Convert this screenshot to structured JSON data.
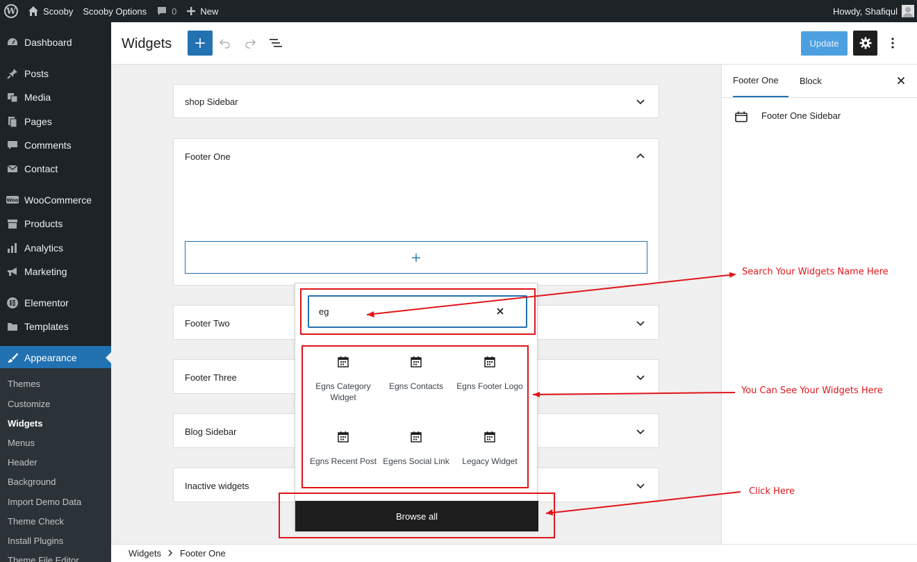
{
  "adminbar": {
    "site_name": "Scooby",
    "options_label": "Scooby Options",
    "comments_count": "0",
    "new_label": "New",
    "greeting": "Howdy, Shafiqul"
  },
  "sidebar": {
    "items": [
      {
        "label": "Dashboard",
        "icon": "dashboard-icon"
      },
      {
        "label": "Posts",
        "icon": "pin-icon"
      },
      {
        "label": "Media",
        "icon": "media-icon"
      },
      {
        "label": "Pages",
        "icon": "pages-icon"
      },
      {
        "label": "Comments",
        "icon": "comment-icon"
      },
      {
        "label": "Contact",
        "icon": "mail-icon"
      },
      {
        "label": "WooCommerce",
        "icon": "woo-icon"
      },
      {
        "label": "Products",
        "icon": "archive-icon"
      },
      {
        "label": "Analytics",
        "icon": "chart-icon"
      },
      {
        "label": "Marketing",
        "icon": "megaphone-icon"
      },
      {
        "label": "Elementor",
        "icon": "elementor-icon"
      },
      {
        "label": "Templates",
        "icon": "folder-icon"
      },
      {
        "label": "Appearance",
        "icon": "brush-icon"
      }
    ],
    "submenu": [
      "Themes",
      "Customize",
      "Widgets",
      "Menus",
      "Header",
      "Background",
      "Import Demo Data",
      "Theme Check",
      "Install Plugins",
      "Theme File Editor"
    ],
    "current_submenu": "Widgets"
  },
  "header": {
    "title": "Widgets",
    "update_label": "Update"
  },
  "widget_areas": [
    {
      "title": "shop Sidebar"
    },
    {
      "title": "Footer One"
    },
    {
      "title": "Footer Two"
    },
    {
      "title": "Footer Three"
    },
    {
      "title": "Blog Sidebar"
    },
    {
      "title": "Inactive widgets"
    }
  ],
  "inserter": {
    "search_value": "eg",
    "blocks": [
      {
        "label": "Egns Category Widget",
        "icon": "calendar-icon"
      },
      {
        "label": "Egns Contacts",
        "icon": "calendar-icon"
      },
      {
        "label": "Egns Footer Logo",
        "icon": "calendar-icon"
      },
      {
        "label": "Egns Recent Post",
        "icon": "calendar-icon"
      },
      {
        "label": "Egens Social Link",
        "icon": "calendar-icon"
      },
      {
        "label": "Legacy Widget",
        "icon": "calendar-icon"
      }
    ],
    "browse_all_label": "Browse all"
  },
  "right_panel": {
    "tabs": [
      "Footer One",
      "Block"
    ],
    "active_tab": "Footer One",
    "item_label": "Footer One Sidebar"
  },
  "breadcrumb": [
    "Widgets",
    "Footer One"
  ],
  "annotations": {
    "search_note": "Search Your Widgets Name Here",
    "widgets_note": "You Can See Your Widgets Here",
    "click_note": "Click Here",
    "color": "#e0141a"
  }
}
